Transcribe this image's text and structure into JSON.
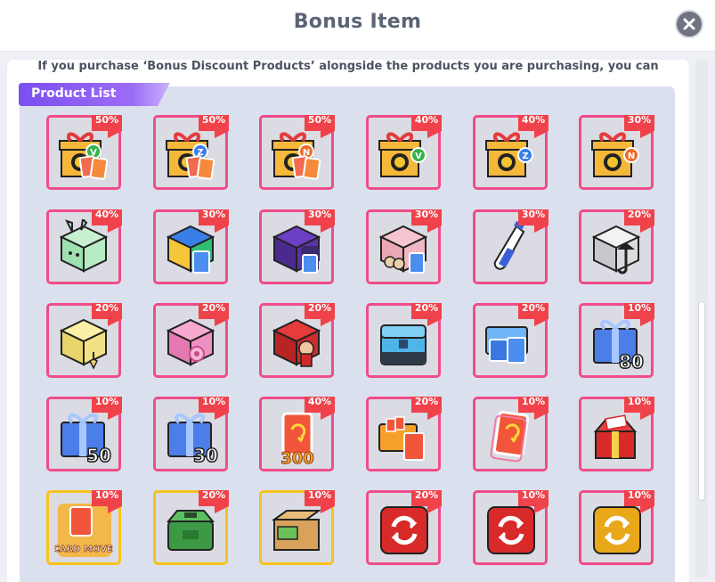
{
  "dialog": {
    "title": "Bonus Item",
    "notice": "If you purchase ‘Bonus Discount Products’ alongside the products you are purchasing, you can",
    "list_label": "Product List",
    "close_icon": "close-icon"
  },
  "colors": {
    "accent_purple": "#7b4ff0",
    "item_border_pink": "#f04c88",
    "item_border_gold": "#f7c21c",
    "badge_red": "#f0424a"
  },
  "products": [
    {
      "discount": "50%",
      "icon": "gift-box-cards-v-icon",
      "border": "pink"
    },
    {
      "discount": "50%",
      "icon": "gift-box-cards-z-icon",
      "border": "pink"
    },
    {
      "discount": "50%",
      "icon": "gift-box-cards-n-icon",
      "border": "pink"
    },
    {
      "discount": "40%",
      "icon": "gift-box-v-icon",
      "border": "pink"
    },
    {
      "discount": "40%",
      "icon": "gift-box-z-icon",
      "border": "pink"
    },
    {
      "discount": "30%",
      "icon": "gift-box-n-icon",
      "border": "pink"
    },
    {
      "discount": "40%",
      "icon": "bunny-cube-icon",
      "border": "pink"
    },
    {
      "discount": "30%",
      "icon": "color-cubes-cards-icon",
      "border": "pink"
    },
    {
      "discount": "30%",
      "icon": "purple-cube-character-icon",
      "border": "pink"
    },
    {
      "discount": "30%",
      "icon": "pink-cube-figures-icon",
      "border": "pink"
    },
    {
      "discount": "30%",
      "icon": "milk-bottle-icon",
      "border": "pink"
    },
    {
      "discount": "20%",
      "icon": "white-cube-umbrella-icon",
      "border": "pink"
    },
    {
      "discount": "20%",
      "icon": "yellow-cube-pendant-icon",
      "border": "pink"
    },
    {
      "discount": "20%",
      "icon": "pink-cube-flower-icon",
      "border": "pink"
    },
    {
      "discount": "20%",
      "icon": "red-cube-character-icon",
      "border": "pink"
    },
    {
      "discount": "20%",
      "icon": "blue-chest-icon",
      "border": "pink"
    },
    {
      "discount": "20%",
      "icon": "blue-card-pack-icon",
      "border": "pink"
    },
    {
      "discount": "10%",
      "icon": "blue-gift-80-icon",
      "border": "pink",
      "count": "80"
    },
    {
      "discount": "10%",
      "icon": "blue-gift-50-icon",
      "border": "pink",
      "count": "50"
    },
    {
      "discount": "10%",
      "icon": "blue-gift-30-icon",
      "border": "pink",
      "count": "30"
    },
    {
      "discount": "40%",
      "icon": "orange-card-300-icon",
      "border": "pink",
      "count": "300"
    },
    {
      "discount": "20%",
      "icon": "orange-card-box-icon",
      "border": "pink"
    },
    {
      "discount": "10%",
      "icon": "orange-card-icon",
      "border": "pink"
    },
    {
      "discount": "10%",
      "icon": "red-gift-box-icon",
      "border": "pink"
    },
    {
      "discount": "10%",
      "icon": "card-move-icon",
      "border": "gold",
      "label": "CARD MOVE"
    },
    {
      "discount": "20%",
      "icon": "green-cash-box-icon",
      "border": "gold"
    },
    {
      "discount": "10%",
      "icon": "cardboard-cash-box-icon",
      "border": "gold"
    },
    {
      "discount": "20%",
      "icon": "red-refresh-tile-icon",
      "border": "pink"
    },
    {
      "discount": "10%",
      "icon": "red-refresh-tile-icon",
      "border": "pink"
    },
    {
      "discount": "10%",
      "icon": "gold-refresh-tile-icon",
      "border": "pink"
    }
  ]
}
